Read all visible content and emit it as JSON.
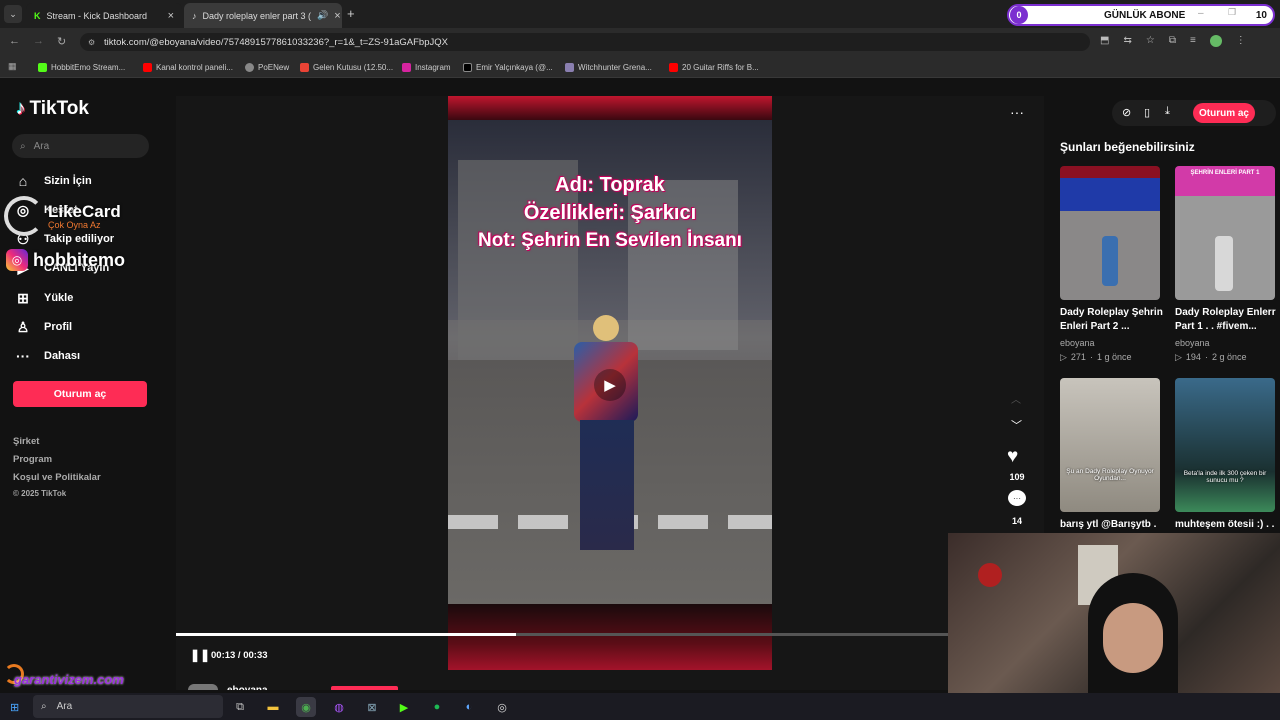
{
  "browser": {
    "tabs": [
      {
        "label": "Stream - Kick Dashboard",
        "icon": "kick-icon"
      },
      {
        "label": "Dady roleplay enler part 3 (",
        "icon": "tiktok-icon"
      }
    ],
    "url": "tiktok.com/@eboyana/video/7574891577861033236?_r=1&_t=ZS-91aGAFbpJQX",
    "bookmarks": [
      "HobbitEmo Stream...",
      "Kanal kontrol paneli...",
      "PoENew",
      "Gelen Kutusu (12.50...",
      "Instagram",
      "Emir Yalçınkaya (@...",
      "Witchhunter Grena...",
      "20 Guitar Riffs for B..."
    ]
  },
  "overlay": {
    "sub_count": "0",
    "sub_label": "GÜNLÜK ABONE",
    "sub_goal": "10",
    "likecard": "LikeCard",
    "likecard_sub": "Çok Oyna  Az",
    "instagram": "hobbitemo",
    "sponsor": "garantivizem.com"
  },
  "tiktok": {
    "logo": "TikTok",
    "search_placeholder": "Ara",
    "nav": [
      {
        "label": "Sizin İçin",
        "icon": "home-icon"
      },
      {
        "label": "Keşfet",
        "icon": "compass-icon"
      },
      {
        "label": "Takip ediliyor",
        "icon": "following-icon"
      },
      {
        "label": "CANLI Yayın",
        "icon": "live-icon"
      },
      {
        "label": "Yükle",
        "icon": "upload-icon"
      },
      {
        "label": "Profil",
        "icon": "profile-icon"
      },
      {
        "label": "Dahası",
        "icon": "more-icon"
      }
    ],
    "login": "Oturum aç",
    "footer": [
      "Şirket",
      "Program",
      "Koşul ve Politikalar",
      "© 2025 TikTok"
    ],
    "video": {
      "captions": [
        "Adı: Toprak",
        "Özellikleri: Şarkıcı",
        "Not: Şehrin En Sevilen İnsanı"
      ],
      "time": "00:13 / 00:33",
      "progress": 0.44,
      "author": "eboyana",
      "likes": "109",
      "comments": "14"
    },
    "suggest_title": "Şunları beğenebilirsiniz",
    "suggestions": [
      {
        "title": "Dady Roleplay Şehrin Enleri Part 2 ...",
        "author": "eboyana",
        "views": "271",
        "age": "1 g önce"
      },
      {
        "title": "Dady Roleplay Enlerr Part 1 . . #fivem...",
        "author": "eboyana",
        "views": "194",
        "age": "2 g önce"
      },
      {
        "title": "barış ytl @Barışytb .",
        "thumb_text": "Şu an Dady Roleplay Oynuyor Oyundan..."
      },
      {
        "title": "muhteşem ötesii :) . .",
        "thumb_text": "Beta'la inde ilk 300 çeken bir sunucu mu ?"
      }
    ],
    "thumb1_text": "ŞEHRİN ENLERİ PART 1"
  },
  "taskbar": {
    "search": "Ara"
  }
}
